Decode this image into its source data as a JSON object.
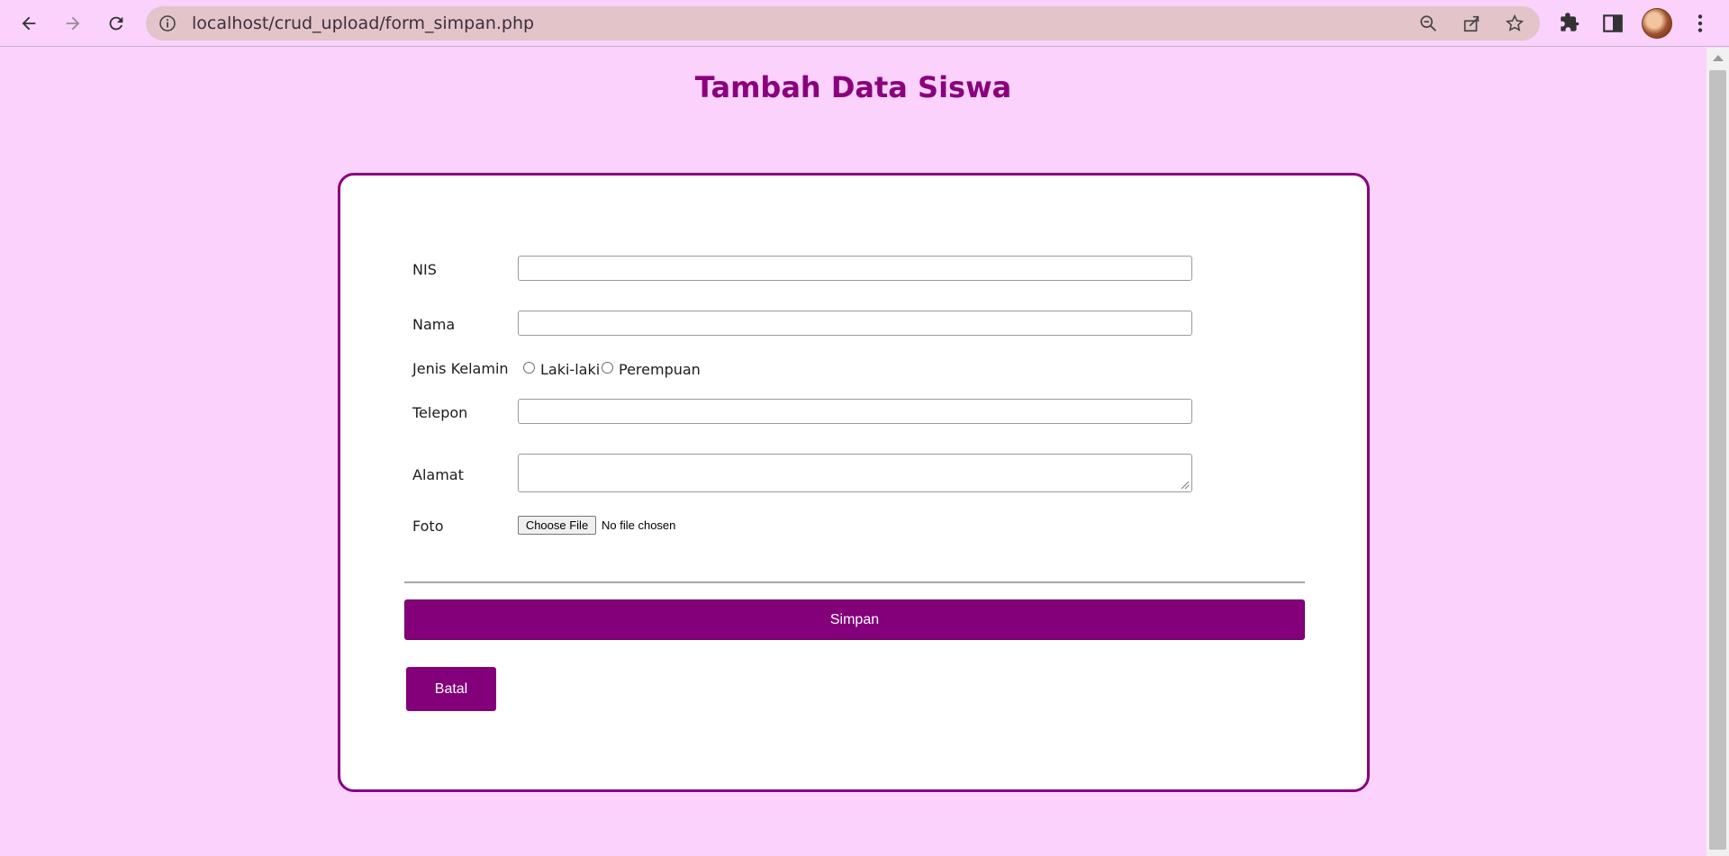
{
  "browser": {
    "url": "localhost/crud_upload/form_simpan.php"
  },
  "page": {
    "title": "Tambah Data Siswa"
  },
  "form": {
    "nis_label": "NIS",
    "nama_label": "Nama",
    "gender_label": "Jenis Kelamin",
    "gender_options": [
      "Laki-laki",
      "Perempuan"
    ],
    "telepon_label": "Telepon",
    "alamat_label": "Alamat",
    "foto_label": "Foto",
    "file_button": "Choose File",
    "file_status": "No file chosen",
    "save_button": "Simpan",
    "cancel_button": "Batal"
  },
  "colors": {
    "accent": "#84007a",
    "page_background": "#fad2fc",
    "title": "#8a007d"
  }
}
